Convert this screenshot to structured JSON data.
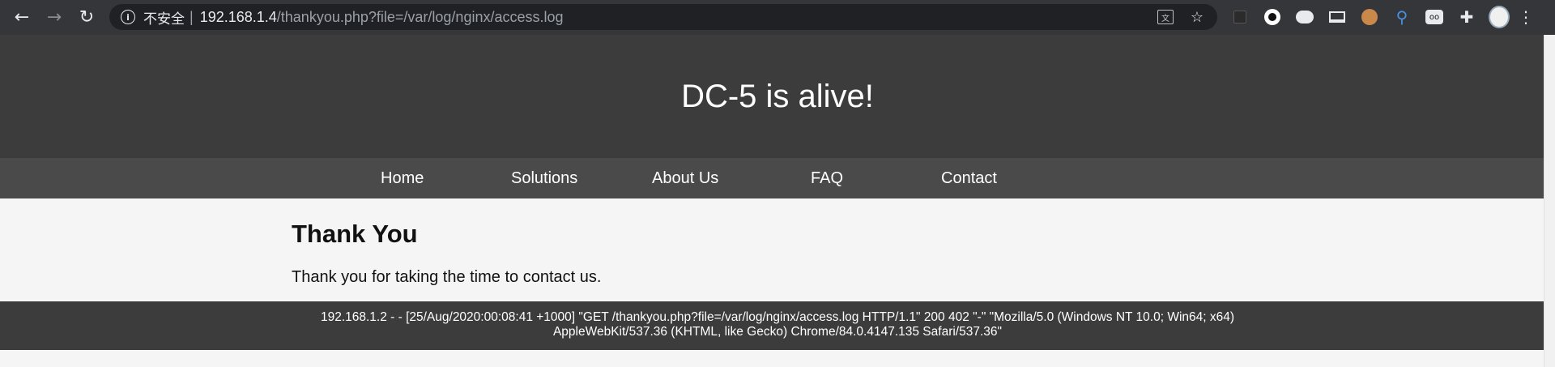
{
  "browser": {
    "insecure_label": "不安全",
    "separator": "|",
    "url_host": "192.168.1.4",
    "url_path": "/thankyou.php?file=/var/log/nginx/access.log",
    "icons": [
      "back-icon",
      "forward-icon",
      "reload-icon",
      "info-icon",
      "translate-icon",
      "star-icon",
      "extension-icons",
      "puzzle-icon",
      "avatar",
      "menu-icon"
    ]
  },
  "site": {
    "title": "DC-5 is alive!",
    "nav": [
      "Home",
      "Solutions",
      "About Us",
      "FAQ",
      "Contact"
    ]
  },
  "main": {
    "heading": "Thank You",
    "message": "Thank you for taking the time to contact us."
  },
  "footer": {
    "line1": "192.168.1.2 - - [25/Aug/2020:00:08:41 +1000] \"GET /thankyou.php?file=/var/log/nginx/access.log HTTP/1.1\" 200 402 \"-\" \"Mozilla/5.0 (Windows NT 10.0; Win64; x64)",
    "line2": "AppleWebKit/537.36 (KHTML, like Gecko) Chrome/84.0.4147.135 Safari/537.36\""
  },
  "colors": {
    "chrome_bg": "#35363a",
    "omnibox_bg": "#202124",
    "header_bg": "#3c3c3c",
    "nav_bg": "#4a4a4a",
    "content_bg": "#f5f5f5"
  }
}
